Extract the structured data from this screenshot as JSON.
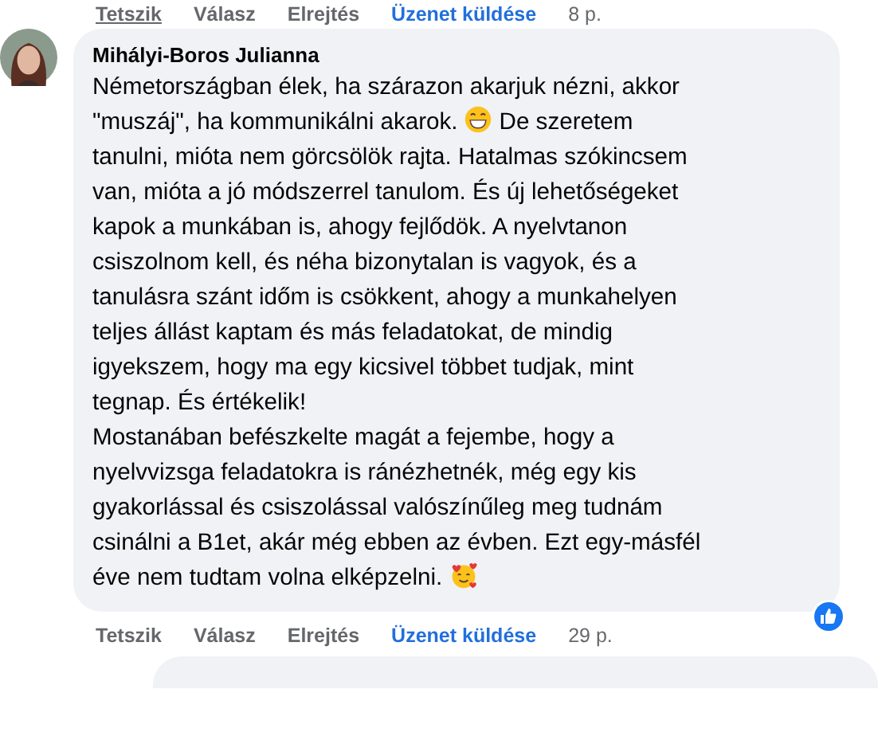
{
  "previous_actions": {
    "like": "Tetszik",
    "reply": "Válasz",
    "hide": "Elrejtés",
    "message": "Üzenet küldése",
    "time": "8 p."
  },
  "comment": {
    "author": "Mihályi-Boros Julianna",
    "lines": [
      [
        {
          "kind": "text",
          "text": "Németországban élek, ha szárazon akarjuk nézni, akkor"
        }
      ],
      [
        {
          "kind": "text",
          "text": "\"muszáj\", ha kommunikálni akarok."
        },
        {
          "kind": "grin_emoji"
        },
        {
          "kind": "text",
          "text": "De szeretem"
        }
      ],
      [
        {
          "kind": "text",
          "text": "tanulni, mióta nem görcsölök rajta. Hatalmas szókincsem"
        }
      ],
      [
        {
          "kind": "text",
          "text": "van, mióta a jó módszerrel tanulom. És új lehetőségeket"
        }
      ],
      [
        {
          "kind": "text",
          "text": "kapok a munkában is, ahogy fejlődök. A nyelvtanon"
        }
      ],
      [
        {
          "kind": "text",
          "text": "csiszolnom kell, és néha bizonytalan is vagyok, és a"
        }
      ],
      [
        {
          "kind": "text",
          "text": "tanulásra szánt időm is csökkent, ahogy a munkahelyen"
        }
      ],
      [
        {
          "kind": "text",
          "text": "teljes állást kaptam és más feladatokat, de mindig"
        }
      ],
      [
        {
          "kind": "text",
          "text": "igyekszem, hogy ma egy kicsivel többet tudjak, mint"
        }
      ],
      [
        {
          "kind": "text",
          "text": "tegnap. És értékelik!"
        }
      ],
      [
        {
          "kind": "text",
          "text": "Mostanában befészkelte magát a fejembe, hogy a"
        }
      ],
      [
        {
          "kind": "text",
          "text": "nyelvvizsga feladatokra is ránézhetnék, még egy kis"
        }
      ],
      [
        {
          "kind": "text",
          "text": "gyakorlással és csiszolással valószínűleg meg tudnám"
        }
      ],
      [
        {
          "kind": "text",
          "text": "csinálni a B1et, akár még ebben az évben. Ezt egy-másfél"
        }
      ],
      [
        {
          "kind": "text",
          "text": "éve nem tudtam volna elképzelni."
        },
        {
          "kind": "hearts_emoji"
        }
      ]
    ],
    "actions": {
      "like": "Tetszik",
      "reply": "Válasz",
      "hide": "Elrejtés",
      "message": "Üzenet küldése",
      "time": "29 p."
    }
  }
}
